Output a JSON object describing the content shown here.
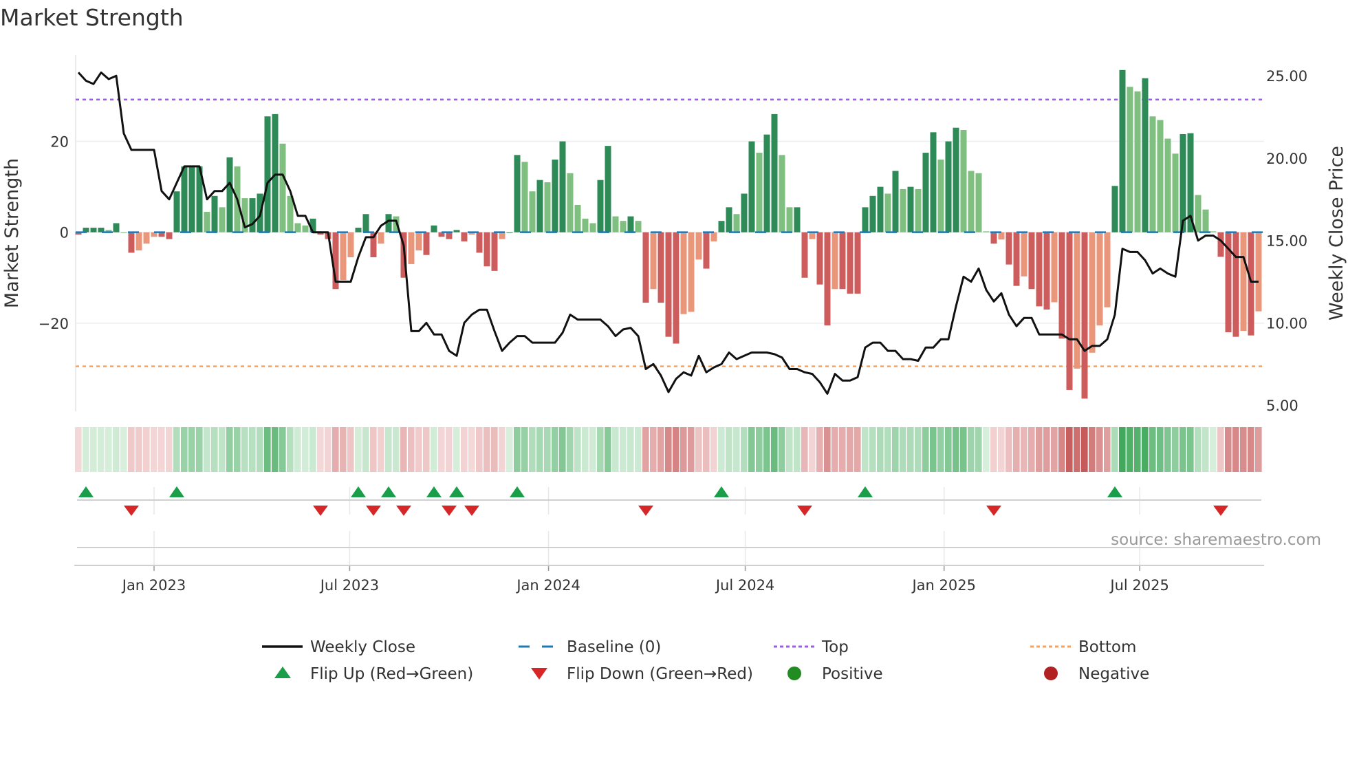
{
  "title": "Market Strength",
  "source": "source: sharemaestro.com",
  "chart_data": {
    "type": "bar+line",
    "title": "Market Strength",
    "xlabel": "",
    "ylabel": "Market Strength",
    "ylabel_right": "Weekly Close Price",
    "frequency": "weekly",
    "start_date": "2022-10-23",
    "ylim": [
      -39.4,
      39
    ],
    "ylim_right": [
      4.63,
      26.26
    ],
    "yticks": [
      {
        "v": 20,
        "label": "20"
      },
      {
        "v": 0,
        "label": "0"
      },
      {
        "v": -20,
        "label": "−20"
      }
    ],
    "yticks_right": [
      {
        "v": 25,
        "label": "25.00"
      },
      {
        "v": 20,
        "label": "20.00"
      },
      {
        "v": 15,
        "label": "15.00"
      },
      {
        "v": 10,
        "label": "10.00"
      },
      {
        "v": 5,
        "label": "5.00"
      }
    ],
    "xticks": [
      {
        "date": "2023-01-01",
        "label": "Jan 2023"
      },
      {
        "date": "2023-07-01",
        "label": "Jul 2023"
      },
      {
        "date": "2024-01-01",
        "label": "Jan 2024"
      },
      {
        "date": "2024-07-01",
        "label": "Jul 2024"
      },
      {
        "date": "2025-01-01",
        "label": "Jan 2025"
      },
      {
        "date": "2025-07-01",
        "label": "Jul 2025"
      }
    ],
    "top_level": 29.2,
    "bottom_level": -29.5,
    "baseline": 0,
    "strength": [
      -0.5,
      1,
      1,
      1,
      0.5,
      2,
      0,
      -4.5,
      -4,
      -2.5,
      -1,
      -1,
      -1.5,
      9,
      14.5,
      14.5,
      14.5,
      4.5,
      8,
      5.5,
      16.5,
      14.5,
      7.5,
      7.5,
      8.5,
      25.5,
      26,
      19.5,
      8,
      2,
      1.5,
      3,
      -0.5,
      -1.5,
      -12.5,
      -10.5,
      -5.5,
      1,
      4,
      -5.5,
      -2.5,
      4,
      3.5,
      -10,
      -7,
      -4,
      -5,
      1.5,
      -1,
      -1.5,
      0.5,
      -2,
      -0.5,
      -4.5,
      -7.5,
      -8.5,
      -1.5,
      0,
      17,
      15.5,
      9,
      11.5,
      11,
      16,
      20,
      13,
      6,
      3,
      2,
      11.5,
      19,
      3.5,
      2.5,
      3.5,
      2.5,
      -15.5,
      -12.5,
      -15.5,
      -23,
      -24.5,
      -18,
      -17.5,
      -6,
      -8,
      -2,
      2.5,
      5.5,
      4,
      8.5,
      20,
      17.5,
      21.5,
      26,
      17,
      5.5,
      5.5,
      -10,
      -1.5,
      -11.5,
      -20.5,
      -12.5,
      -12.5,
      -13.5,
      -13.5,
      5.5,
      8,
      10,
      8.5,
      13.5,
      9.5,
      10,
      9.5,
      17.5,
      22,
      16,
      20,
      23,
      22.5,
      13.5,
      13,
      0.2,
      -2.5,
      -1.6,
      -7.1,
      -11.8,
      -9.7,
      -12.5,
      -16.3,
      -17,
      -15.4,
      -23.4,
      -34.7,
      -30,
      -36.6,
      -26.5,
      -20.5,
      -16.5,
      10.2,
      35.7,
      32,
      31,
      33.9,
      25.5,
      24.7,
      20.6,
      17.3,
      21.6,
      21.8,
      8.2,
      5,
      0.2,
      -5.4,
      -22,
      -23,
      -21.7,
      -22.7,
      -17.4
    ],
    "weekly_close": [
      25.2,
      24.7,
      24.5,
      25.2,
      24.8,
      25,
      21.5,
      20.5,
      20.5,
      20.5,
      20.5,
      18,
      17.5,
      18.5,
      19.5,
      19.5,
      19.5,
      17.5,
      18,
      18,
      18.5,
      17.5,
      15.8,
      16,
      16.5,
      18.5,
      19,
      19,
      18,
      16.5,
      16.5,
      15.5,
      15.5,
      15.5,
      12.5,
      12.5,
      12.5,
      14,
      15.2,
      15.2,
      15.9,
      16.2,
      16.2,
      14.7,
      9.5,
      9.5,
      10,
      9.3,
      9.3,
      8.3,
      8,
      10,
      10.5,
      10.8,
      10.8,
      9.5,
      8.3,
      8.8,
      9.2,
      9.2,
      8.8,
      8.8,
      8.8,
      8.8,
      9.4,
      10.5,
      10.2,
      10.2,
      10.2,
      10.2,
      9.8,
      9.2,
      9.6,
      9.7,
      9.2,
      7.2,
      7.5,
      6.8,
      5.8,
      6.6,
      7,
      6.8,
      8,
      7,
      7.3,
      7.5,
      8.2,
      7.8,
      8,
      8.2,
      8.2,
      8.2,
      8.1,
      7.9,
      7.2,
      7.2,
      7,
      6.9,
      6.4,
      5.7,
      6.9,
      6.5,
      6.5,
      6.7,
      8.5,
      8.8,
      8.8,
      8.3,
      8.3,
      7.8,
      7.8,
      7.7,
      8.5,
      8.5,
      9,
      9,
      11,
      12.8,
      12.5,
      13.3,
      12,
      11.3,
      11.8,
      10.5,
      9.8,
      10.3,
      10.3,
      9.3,
      9.3,
      9.3,
      9.3,
      9,
      9,
      8.3,
      8.6,
      8.6,
      9,
      10.5,
      14.5,
      14.3,
      14.3,
      13.8,
      13,
      13.3,
      13,
      12.8,
      16.2,
      16.5,
      15,
      15.3,
      15.3,
      15,
      14.5,
      14,
      14,
      12.5,
      12.5
    ],
    "flip_up_dates": [
      "2022-10-30",
      "2023-01-22",
      "2023-07-09",
      "2023-08-06",
      "2023-09-17",
      "2023-10-08",
      "2023-12-03",
      "2024-06-09",
      "2024-10-20",
      "2025-06-08"
    ],
    "flip_down_dates": [
      "2022-12-11",
      "2023-06-04",
      "2023-07-23",
      "2023-08-20",
      "2023-10-01",
      "2023-10-22",
      "2024-03-31",
      "2024-08-25",
      "2025-02-16",
      "2025-09-14"
    ],
    "legend": {
      "placement": "bottom",
      "items": [
        {
          "label": "Weekly Close",
          "kind": "line",
          "color": "#111111"
        },
        {
          "label": "Baseline (0)",
          "kind": "dash",
          "color": "#1f77b4"
        },
        {
          "label": "Top",
          "kind": "dot",
          "color": "#9b5de5"
        },
        {
          "label": "Bottom",
          "kind": "dot",
          "color": "#f4a261"
        },
        {
          "label": "Flip Up (Red→Green)",
          "kind": "tri-up",
          "color": "#1a9e4a"
        },
        {
          "label": "Flip Down (Green→Red)",
          "kind": "tri-down",
          "color": "#d62728"
        },
        {
          "label": "Positive",
          "kind": "circle",
          "color": "#228b22"
        },
        {
          "label": "Negative",
          "kind": "circle",
          "color": "#b22222"
        }
      ]
    },
    "colors": {
      "pos_strong": "#2e8b57",
      "pos_weak": "#7fbf7f",
      "neg_strong": "#cd5c5c",
      "neg_weak": "#e9967a",
      "top": "#9b5de5",
      "bottom": "#f4a261",
      "baseline": "#1f77b4",
      "close": "#111111"
    }
  }
}
